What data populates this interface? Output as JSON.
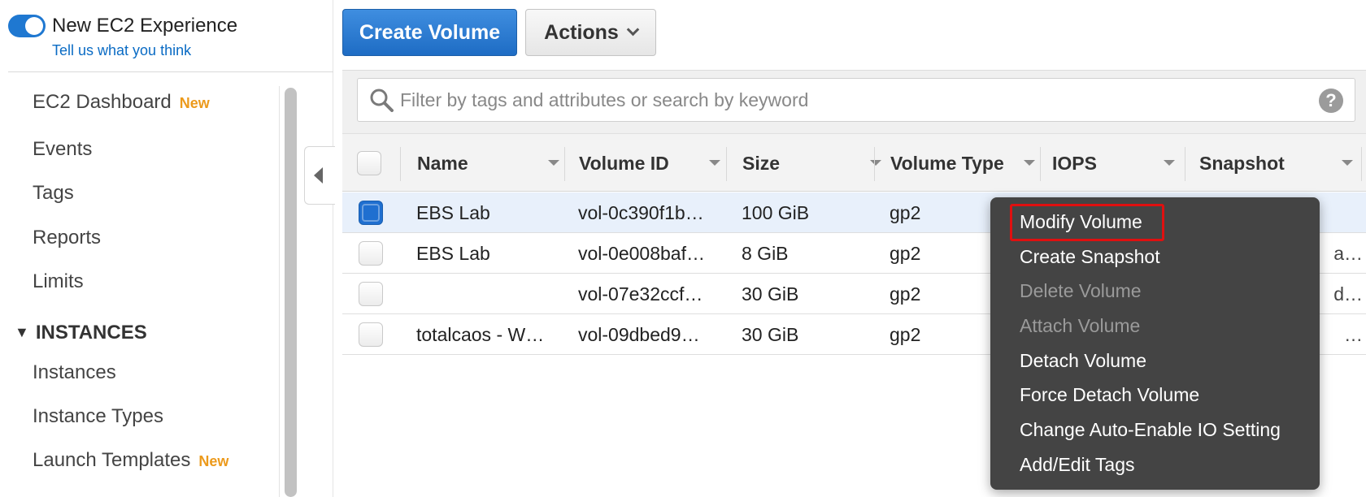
{
  "sidebar": {
    "experience": {
      "title": "New EC2 Experience",
      "link": "Tell us what you think"
    },
    "items": [
      {
        "label": "EC2 Dashboard",
        "badge": "New"
      },
      {
        "label": "Events"
      },
      {
        "label": "Tags"
      },
      {
        "label": "Reports"
      },
      {
        "label": "Limits"
      }
    ],
    "section": {
      "label": "INSTANCES",
      "items": [
        {
          "label": "Instances"
        },
        {
          "label": "Instance Types"
        },
        {
          "label": "Launch Templates",
          "badge": "New"
        }
      ]
    }
  },
  "toolbar": {
    "create_label": "Create Volume",
    "actions_label": "Actions"
  },
  "search": {
    "placeholder": "Filter by tags and attributes or search by keyword",
    "help": "?"
  },
  "table": {
    "columns": [
      "Name",
      "Volume ID",
      "Size",
      "Volume Type",
      "IOPS",
      "Snapshot"
    ],
    "rows": [
      {
        "name": "EBS Lab",
        "volume_id": "vol-0c390f1b…",
        "size": "100 GiB",
        "type": "gp2",
        "selected": true,
        "snapshot_tail": ""
      },
      {
        "name": "EBS Lab",
        "volume_id": "vol-0e008baf…",
        "size": "8 GiB",
        "type": "gp2",
        "selected": false,
        "snapshot_tail": "a…"
      },
      {
        "name": "",
        "volume_id": "vol-07e32ccf…",
        "size": "30 GiB",
        "type": "gp2",
        "selected": false,
        "snapshot_tail": "d…"
      },
      {
        "name": "totalcaos - W…",
        "volume_id": "vol-09dbed9…",
        "size": "30 GiB",
        "type": "gp2",
        "selected": false,
        "snapshot_tail": "…"
      }
    ]
  },
  "context_menu": {
    "items": [
      {
        "label": "Modify Volume",
        "enabled": true,
        "highlighted": true
      },
      {
        "label": "Create Snapshot",
        "enabled": true
      },
      {
        "label": "Delete Volume",
        "enabled": false
      },
      {
        "label": "Attach Volume",
        "enabled": false
      },
      {
        "label": "Detach Volume",
        "enabled": true
      },
      {
        "label": "Force Detach Volume",
        "enabled": true
      },
      {
        "label": "Change Auto-Enable IO Setting",
        "enabled": true
      },
      {
        "label": "Add/Edit Tags",
        "enabled": true
      }
    ]
  },
  "colors": {
    "primary": "#1f78d1",
    "new_badge": "#ec9a1c",
    "menu_bg": "#444444",
    "highlight": "#e01010",
    "selected_row": "#e8f0fb"
  }
}
